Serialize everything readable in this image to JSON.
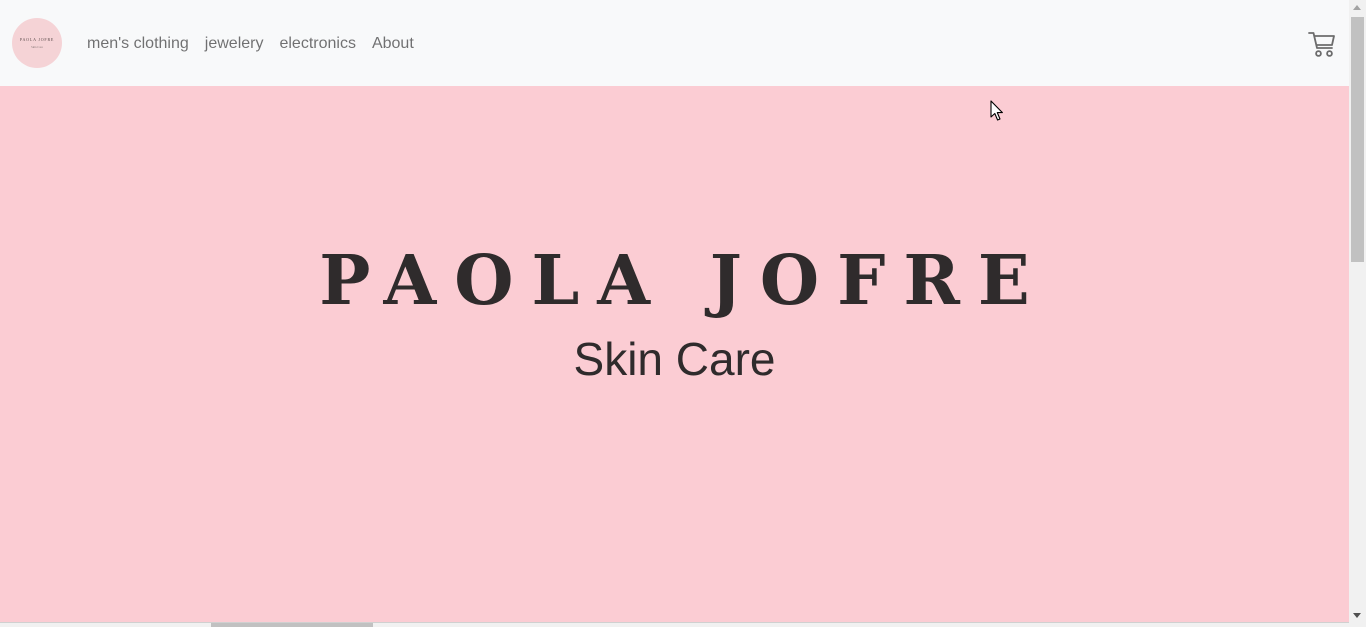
{
  "brand": {
    "logo_text": "PAOLA JOFRE",
    "logo_sub": "Skin Care",
    "logo_color": "#f5d3d6"
  },
  "nav": {
    "items": [
      {
        "label": "men's clothing"
      },
      {
        "label": "jewelery"
      },
      {
        "label": "electronics"
      },
      {
        "label": "About"
      }
    ],
    "cart_icon": "shopping-cart-icon"
  },
  "hero": {
    "title": "PAOLA JOFRE",
    "subtitle": "Skin Care",
    "background": "#fbccd3",
    "text_color": "#2f2b2c"
  }
}
